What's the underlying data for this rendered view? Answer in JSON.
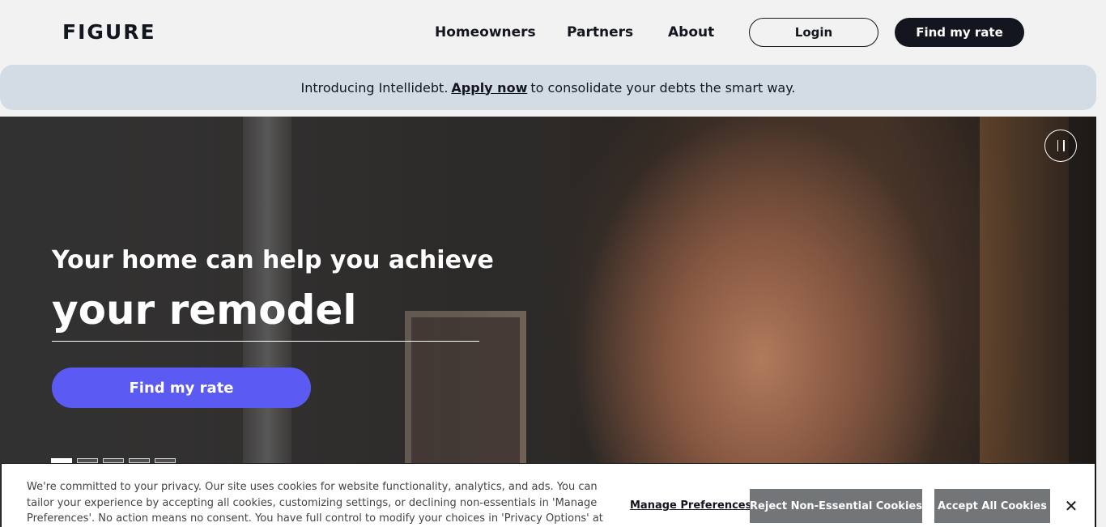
{
  "header": {
    "logo": "FIGURE",
    "nav": [
      "Homeowners",
      "Partners",
      "About"
    ],
    "login_label": "Login",
    "find_rate_label": "Find my rate"
  },
  "announcement": {
    "prefix": "Introducing Intellidebt.",
    "link": "Apply now",
    "suffix": "to consolidate your debts the smart way."
  },
  "hero": {
    "subtitle": "Your home can help you achieve",
    "title": "your remodel",
    "cta_label": "Find my rate",
    "pause_icon": "pause-icon",
    "slides": 5,
    "active_slide": 1
  },
  "cookie": {
    "text": "We're committed to your privacy. Our site uses cookies for website functionality, analytics, and ads. You can tailor your experience by accepting all cookies, customizing settings, or declining non-essentials in 'Manage Preferences'. No action means no consent. You have full control to modify your choices in 'Privacy Options' at any time. For more",
    "manage_label": "Manage Preferences",
    "reject_label": "Reject Non-Essential Cookies",
    "accept_label": "Accept All Cookies",
    "close_glyph": "✕"
  },
  "colors": {
    "accent": "#5b5bf4",
    "dark": "#14161f",
    "banner": "#d3dce4",
    "cookie_button": "#727679"
  }
}
